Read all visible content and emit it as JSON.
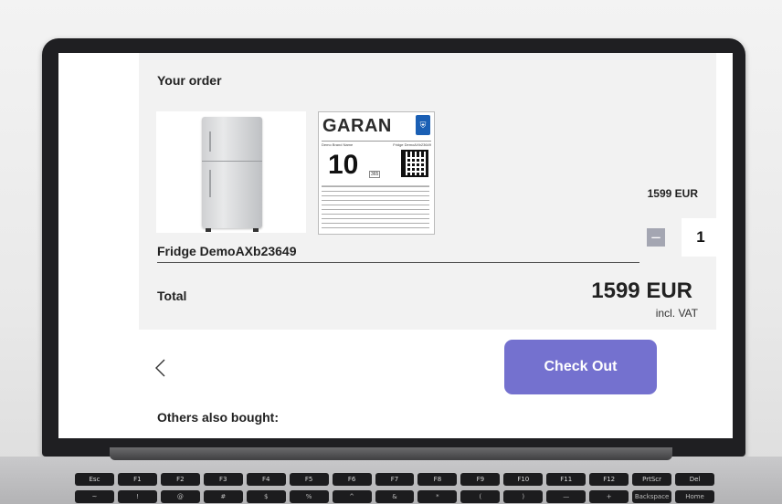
{
  "order": {
    "title": "Your order",
    "product": {
      "name": "Fridge DemoAXb23649",
      "unit_price": "1599 EUR",
      "quantity": "1",
      "minus_label": "−",
      "plus_label": "+"
    },
    "warranty_label": {
      "brand": "GARAN",
      "brand_name_field": "Demo Brand Name",
      "model_field": "Fridge DemoAXb23649",
      "years": "10",
      "days": "365"
    },
    "total": {
      "label": "Total",
      "amount": "1599 EUR",
      "vat_note": "incl. VAT"
    }
  },
  "actions": {
    "checkout_label": "Check Out"
  },
  "recommendations": {
    "title": "Others also bought:"
  },
  "keyboard": {
    "row1": [
      "Esc",
      "F1",
      "F2",
      "F3",
      "F4",
      "F5",
      "F6",
      "F7",
      "F8",
      "F9",
      "F10",
      "F11",
      "F12",
      "PrtScr",
      "Del"
    ],
    "row2": [
      "~",
      "!",
      "@",
      "#",
      "$",
      "%",
      "^",
      "&",
      "*",
      "(",
      ")",
      "—",
      "+",
      "Backspace",
      "Home"
    ]
  },
  "colors": {
    "accent": "#7471cf",
    "plus_button": "#6b6bcf",
    "minus_button": "#a4a6b2",
    "panel_bg": "#f2f2f2"
  }
}
